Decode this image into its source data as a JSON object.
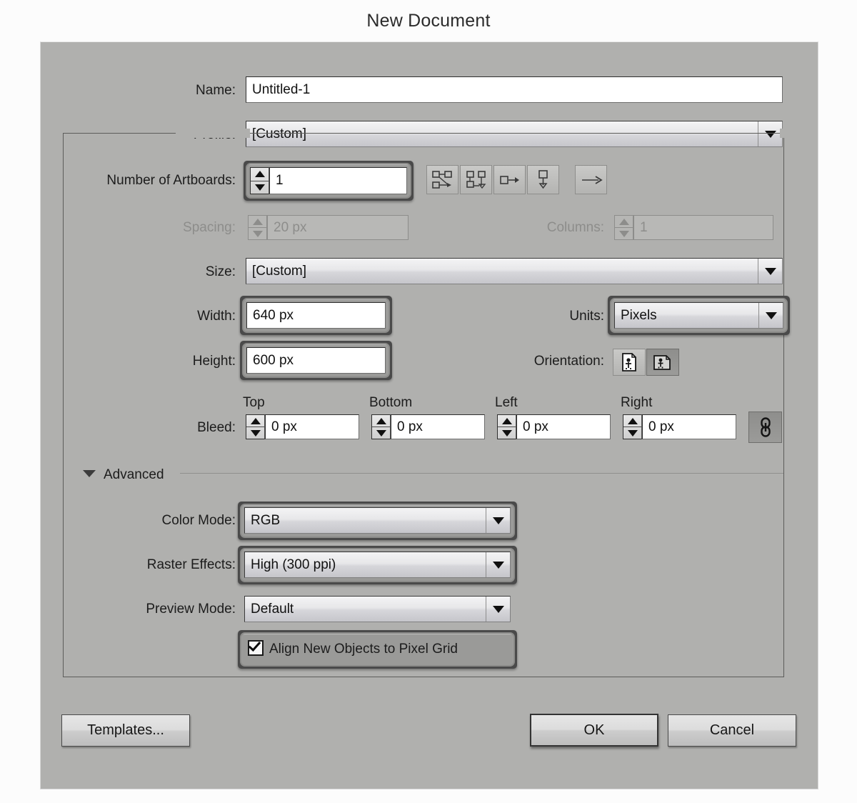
{
  "dialog": {
    "title": "New Document"
  },
  "fields": {
    "name_label": "Name:",
    "name_value": "Untitled-1",
    "profile_label": "Profile:",
    "profile_value": "[Custom]",
    "artboards_label": "Number of Artboards:",
    "artboards_value": "1",
    "spacing_label": "Spacing:",
    "spacing_value": "20 px",
    "columns_label": "Columns:",
    "columns_value": "1",
    "size_label": "Size:",
    "size_value": "[Custom]",
    "width_label": "Width:",
    "width_value": "640 px",
    "height_label": "Height:",
    "height_value": "600 px",
    "units_label": "Units:",
    "units_value": "Pixels",
    "orientation_label": "Orientation:",
    "bleed_label": "Bleed:",
    "bleed_top_label": "Top",
    "bleed_top_value": "0 px",
    "bleed_bottom_label": "Bottom",
    "bleed_bottom_value": "0 px",
    "bleed_left_label": "Left",
    "bleed_left_value": "0 px",
    "bleed_right_label": "Right",
    "bleed_right_value": "0 px"
  },
  "advanced": {
    "section_label": "Advanced",
    "color_mode_label": "Color Mode:",
    "color_mode_value": "RGB",
    "raster_effects_label": "Raster Effects:",
    "raster_effects_value": "High (300 ppi)",
    "preview_mode_label": "Preview Mode:",
    "preview_mode_value": "Default",
    "align_pixel_grid_label": "Align New Objects to Pixel Grid",
    "align_pixel_grid_checked": true
  },
  "footer": {
    "templates_label": "Templates...",
    "ok_label": "OK",
    "cancel_label": "Cancel"
  },
  "icons": {
    "artboard_grid_row": "grid-by-row-icon",
    "artboard_grid_column": "grid-by-column-icon",
    "artboard_row": "arrange-by-row-icon",
    "artboard_column": "arrange-by-column-icon",
    "artboard_direction": "left-to-right-icon",
    "orientation_portrait": "portrait-icon",
    "orientation_landscape": "landscape-icon",
    "bleed_link": "link-bleed-values-icon"
  },
  "colors": {
    "dialog_background": "#b0b0ae",
    "page_background": "#fcfcfc",
    "text": "#1c1c1c",
    "disabled_text": "#8d8d8b",
    "focus_ring": "#4a4a4a",
    "input_background": "#ffffff"
  }
}
